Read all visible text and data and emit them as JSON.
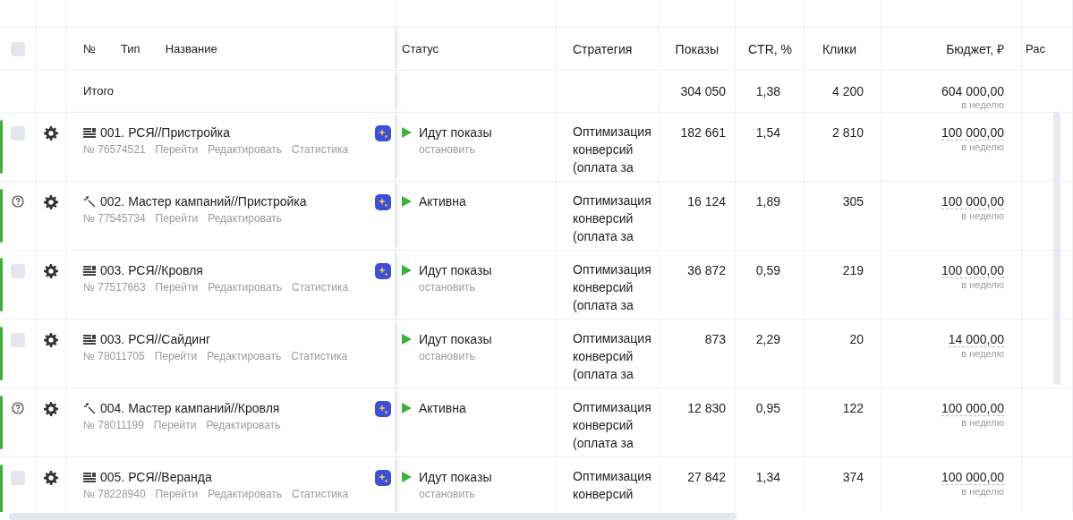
{
  "header": {
    "checked": false,
    "number": "№",
    "type": "Тип",
    "name": "Название",
    "status": "Статус",
    "strategy": "Стратегия",
    "shows": "Показы",
    "ctr": "CTR, %",
    "clicks": "Клики",
    "budget": "Бюджет, ₽",
    "column_11": "Рас"
  },
  "total": {
    "label": "Итого",
    "shows": "304 050",
    "ctr": "1,38",
    "clicks": "4 200",
    "budget": "604 000,00",
    "budget_period": "в неделю"
  },
  "rows": [
    {
      "kind": "rsya",
      "checked": false,
      "title": "001. РСЯ//Пристройка",
      "id": "№ 76574521",
      "links": [
        "Перейти",
        "Редактировать",
        "Статистика"
      ],
      "ai_badge": true,
      "status": "Идут показы",
      "status_action": "остановить",
      "strategy": "Оптимизация конверсий (оплата за",
      "shows": "182 661",
      "ctr": "1,54",
      "clicks": "2 810",
      "budget": "100 000,00",
      "budget_period": "в неделю"
    },
    {
      "kind": "master",
      "title": "002. Мастер кампаний//Пристройка",
      "id": "№ 77545734",
      "links": [
        "Перейти",
        "Редактировать"
      ],
      "ai_badge": true,
      "status": "Активна",
      "strategy": "Оптимизация конверсий (оплата за",
      "shows": "16 124",
      "ctr": "1,89",
      "clicks": "305",
      "budget": "100 000,00",
      "budget_period": "в неделю"
    },
    {
      "kind": "rsya",
      "checked": false,
      "title": "003. РСЯ//Кровля",
      "id": "№ 77517663",
      "links": [
        "Перейти",
        "Редактировать",
        "Статистика"
      ],
      "ai_badge": true,
      "status": "Идут показы",
      "status_action": "остановить",
      "strategy": "Оптимизация конверсий (оплата за",
      "shows": "36 872",
      "ctr": "0,59",
      "clicks": "219",
      "budget": "100 000,00",
      "budget_period": "в неделю"
    },
    {
      "kind": "rsya",
      "checked": false,
      "title": "003. РСЯ//Сайдинг",
      "id": "№ 78011705",
      "links": [
        "Перейти",
        "Редактировать",
        "Статистика"
      ],
      "ai_badge": false,
      "status": "Идут показы",
      "status_action": "остановить",
      "strategy": "Оптимизация конверсий (оплата за",
      "shows": "873",
      "ctr": "2,29",
      "clicks": "20",
      "budget": "14 000,00",
      "budget_period": "в неделю"
    },
    {
      "kind": "master",
      "title": "004. Мастер кампаний//Кровля",
      "id": "№ 78011199",
      "links": [
        "Перейти",
        "Редактировать"
      ],
      "ai_badge": true,
      "status": "Активна",
      "strategy": "Оптимизация конверсий (оплата за",
      "shows": "12 830",
      "ctr": "0,95",
      "clicks": "122",
      "budget": "100 000,00",
      "budget_period": "в неделю"
    },
    {
      "kind": "rsya",
      "checked": false,
      "title": "005. РСЯ//Веранда",
      "id": "№ 78228940",
      "links": [
        "Перейти",
        "Редактировать",
        "Статистика"
      ],
      "ai_badge": true,
      "status": "Идут показы",
      "status_action": "остановить",
      "strategy": "Оптимизация конверсий",
      "shows": "27 842",
      "ctr": "1,34",
      "clicks": "374",
      "budget": "100 000,00",
      "budget_period": "в неделю"
    }
  ]
}
